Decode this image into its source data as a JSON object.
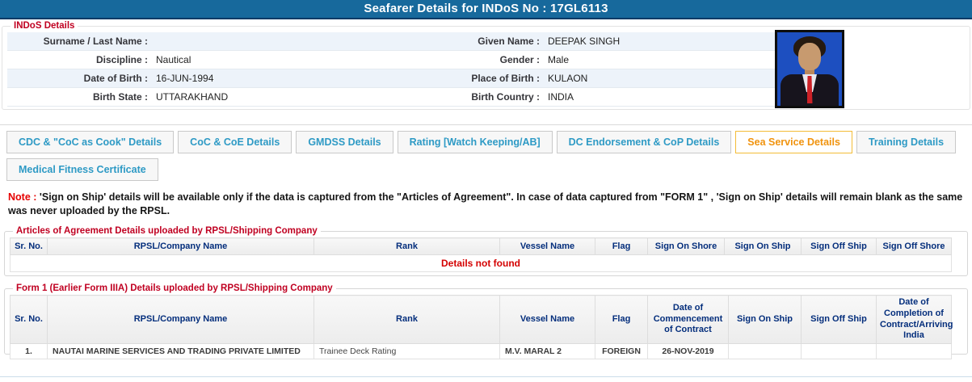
{
  "header": {
    "title": "Seafarer Details for INDoS No : 17GL6113"
  },
  "indos_details": {
    "legend": "INDoS Details",
    "rows": [
      {
        "left_label": "Surname / Last Name :",
        "left_value": "",
        "right_label": "Given Name :",
        "right_value": "DEEPAK SINGH"
      },
      {
        "left_label": "Discipline :",
        "left_value": "Nautical",
        "right_label": "Gender :",
        "right_value": "Male"
      },
      {
        "left_label": "Date of Birth :",
        "left_value": "16-JUN-1994",
        "right_label": "Place of Birth :",
        "right_value": "KULAON"
      },
      {
        "left_label": "Birth State :",
        "left_value": "UTTARAKHAND",
        "right_label": "Birth Country :",
        "right_value": "INDIA"
      }
    ],
    "photo": "seafarer passport photo"
  },
  "tabs": {
    "items": [
      {
        "label": "CDC & \"CoC as Cook\" Details",
        "active": false
      },
      {
        "label": "CoC & CoE Details",
        "active": false
      },
      {
        "label": "GMDSS Details",
        "active": false
      },
      {
        "label": "Rating [Watch Keeping/AB]",
        "active": false
      },
      {
        "label": "DC Endorsement & CoP Details",
        "active": false
      },
      {
        "label": "Sea Service Details",
        "active": true
      },
      {
        "label": "Training Details",
        "active": false
      },
      {
        "label": "Medical Fitness Certificate",
        "active": false
      }
    ]
  },
  "note": {
    "prefix": "Note :",
    "text": " 'Sign on Ship' details will be available only if the data is captured from the \"Articles of Agreement\". In case of data captured from \"FORM 1\" , 'Sign on Ship' details will remain blank as the same was never uploaded by the RPSL."
  },
  "articles_table": {
    "legend": "Articles of Agreement Details uploaded by RPSL/Shipping Company",
    "columns": [
      "Sr. No.",
      "RPSL/Company Name",
      "Rank",
      "Vessel Name",
      "Flag",
      "Sign On Shore",
      "Sign On Ship",
      "Sign Off Ship",
      "Sign Off Shore"
    ],
    "rows": [],
    "empty_message": "Details not found"
  },
  "form1_table": {
    "legend": "Form 1 (Earlier Form IIIA) Details uploaded by RPSL/Shipping Company",
    "columns": [
      "Sr. No.",
      "RPSL/Company Name",
      "Rank",
      "Vessel Name",
      "Flag",
      "Date of Commencement of Contract",
      "Sign On Ship",
      "Sign Off Ship",
      "Date of Completion of Contract/Arriving India"
    ],
    "rows": [
      [
        "1.",
        "NAUTAI MARINE SERVICES AND TRADING PRIVATE LIMITED",
        "Trainee Deck Rating",
        "M.V. MARAL 2",
        "FOREIGN",
        "26-NOV-2019",
        "",
        "",
        ""
      ]
    ]
  },
  "colors": {
    "titlebar_bg": "#17699C",
    "legend_red": "#C00021",
    "tab_text": "#2E9AC5",
    "tab_active_text": "#F0930E",
    "tab_active_border": "#F3BC37",
    "table_header_text": "#042E7C",
    "empty_message_red": "#D40000",
    "stripe_row": "#EDF3FA"
  }
}
